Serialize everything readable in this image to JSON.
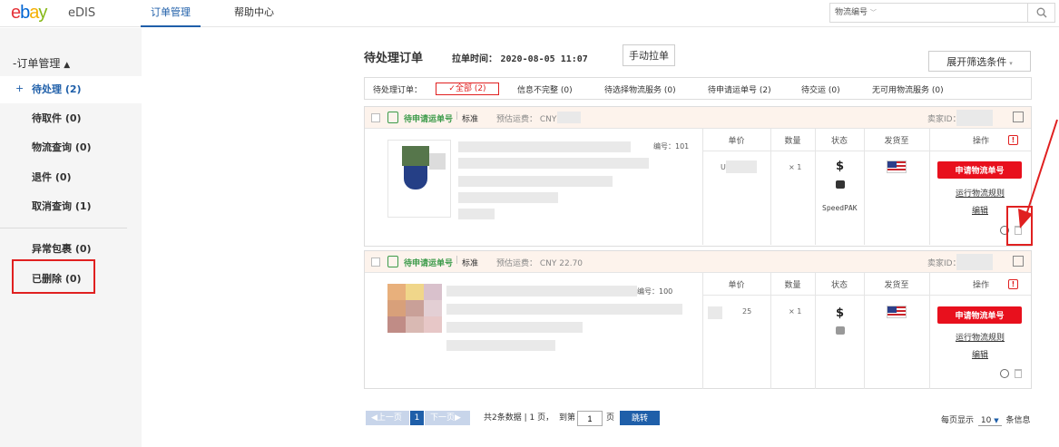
{
  "brand": {
    "logo_e": "e",
    "logo_b": "b",
    "logo_a": "a",
    "logo_y": "y",
    "app": "eDIS"
  },
  "nav": {
    "tabs": [
      {
        "label": "订单管理"
      },
      {
        "label": "帮助中心"
      }
    ]
  },
  "search": {
    "select_label": "物流编号",
    "placeholder": ""
  },
  "sidebar": {
    "heading": "订单管理",
    "items": [
      {
        "label": "待处理 (2)"
      },
      {
        "label": "待取件 (0)"
      },
      {
        "label": "物流查询 (0)"
      },
      {
        "label": "退件 (0)"
      },
      {
        "label": "取消查询 (1)"
      },
      {
        "label": "异常包裹 (0)"
      },
      {
        "label": "已删除 (0)"
      }
    ]
  },
  "main": {
    "title": "待处理订单",
    "pull_time_label": "拉单时间：",
    "pull_time_value": "2020-08-05 11:07",
    "pull_button": "手动拉单",
    "expand_filter": "展开筛选条件",
    "status_filter": {
      "label": "待处理订单：",
      "options": [
        {
          "label": "全部 (2)"
        },
        {
          "label": "信息不完整 (0)"
        },
        {
          "label": "待选择物流服务 (0)"
        },
        {
          "label": "待申请运单号 (2)"
        },
        {
          "label": "待交运 (0)"
        },
        {
          "label": "无可用物流服务 (0)"
        }
      ]
    }
  },
  "columns": {
    "unit_price": "单价",
    "quantity": "数量",
    "status": "状态",
    "ship_to": "发货至",
    "actions": "操作"
  },
  "orders": [
    {
      "status": "待申请运单号",
      "type": "标准",
      "shipping_label": "预估运费：",
      "shipping_value": "CNY",
      "seller_id_label": "卖家ID：",
      "item_no": "编号：101",
      "price_snippet": "U",
      "quantity": "× 1",
      "service": "SpeedPAK",
      "apply_button": "申请物流单号",
      "rules_link": "运行物流规则",
      "edit_link": "编辑"
    },
    {
      "status": "待申请运单号",
      "type": "标准",
      "shipping_label": "预估运费：",
      "shipping_value": "CNY 22.70",
      "seller_id_label": "卖家ID：",
      "item_no": "编号：100",
      "price_snippet": "25",
      "quantity": "× 1",
      "service": "",
      "apply_button": "申请物流单号",
      "rules_link": "运行物流规则",
      "edit_link": "编辑"
    }
  ],
  "pagination": {
    "prev": "上一页",
    "current": "1",
    "next": "下一页",
    "summary": "共2条数据 | 1 页，",
    "goto_label": "到第",
    "goto_value": "1",
    "page_unit": "页",
    "go_button": "跳转",
    "per_page_label": "每页显示",
    "per_page_value": "10",
    "per_page_unit": "条信息"
  },
  "colors": {
    "accent": "#1f5fa9",
    "danger": "#e8101d",
    "success": "#3c9b4a",
    "header_tint": "#fdf3ec"
  }
}
